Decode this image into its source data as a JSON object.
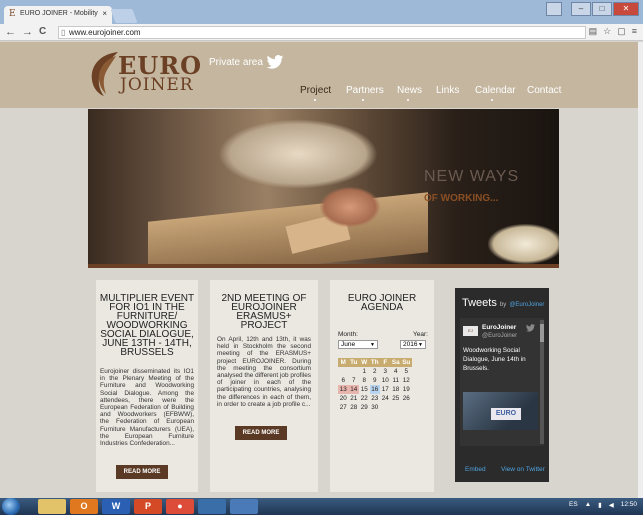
{
  "browser": {
    "tab_title": "EURO JOINER - Mobility ",
    "tab_close": "×",
    "url": "www.eurojoiner.com",
    "nav_back": "←",
    "nav_forward": "→",
    "nav_reload": "C"
  },
  "site": {
    "logo_euro": "EURO",
    "logo_joiner": "JOINER",
    "private_area": "Private area",
    "menu": [
      {
        "label": "Project"
      },
      {
        "label": "Partners"
      },
      {
        "label": "News"
      },
      {
        "label": "Links"
      },
      {
        "label": "Calendar"
      },
      {
        "label": "Contact"
      }
    ],
    "hero": {
      "title": "NEW WAYS",
      "subtitle": "OF WORKING..."
    },
    "col1": {
      "title": "MULTIPLIER EVENT FOR IO1 IN THE FURNITURE/ WOODWORKING SOCIAL DIALOGUE, JUNE 13TH - 14TH, BRUSSELS",
      "body": "Eurojoiner disseminated its IO1 in the Plenary Meeting of the Furniture and Woodworking Social Dialogue. Among the attendees, there were the European Federation of Building and Woodworkers (EFBWW), the Federation of European Furniture Manufacturers (UEA), the European Furniture Industries Confederation...",
      "button": "READ MORE"
    },
    "col2": {
      "title": "2ND MEETING OF EUROJOINER ERASMUS+ PROJECT",
      "body": "On April, 12th and 13th, it was held in Stockholm the second meeting of the ERASMUS+ project EUROJOINER. During the meeting the consortium analysed the different job profiles of joiner in each of the participating countries, analysing the differences in each of them, in order to create a job profile c...",
      "button": "READ MORE"
    },
    "agenda": {
      "title": "EURO JOINER AGENDA",
      "month_label": "Month:",
      "year_label": "Year:",
      "month": "June",
      "year": "2016",
      "weekdays": [
        "M",
        "Tu",
        "W",
        "Th",
        "F",
        "Sa",
        "Su"
      ],
      "weeks": [
        [
          "",
          "",
          "1",
          "2",
          "3",
          "4",
          "5"
        ],
        [
          "6",
          "7",
          "8",
          "9",
          "10",
          "11",
          "12"
        ],
        [
          "13",
          "14",
          "15",
          "16",
          "17",
          "18",
          "19"
        ],
        [
          "20",
          "21",
          "22",
          "23",
          "24",
          "25",
          "26"
        ],
        [
          "27",
          "28",
          "29",
          "30",
          "",
          "",
          ""
        ]
      ]
    },
    "twitter": {
      "title": "Tweets",
      "by": "by",
      "handle_link": "@EuroJoiner",
      "name": "EuroJoiner",
      "handle": "@EuroJoiner",
      "text": "Woodworking Social Dialogue, June 14th in Brussels.",
      "image_text": "EURO",
      "embed": "Embed",
      "view": "View on Twitter"
    }
  },
  "taskbar": {
    "lang": "ES",
    "time": "12:50"
  },
  "colors": {
    "header": "#c4b69f",
    "brown": "#6b4024",
    "accent_orange": "#8a4f24"
  }
}
